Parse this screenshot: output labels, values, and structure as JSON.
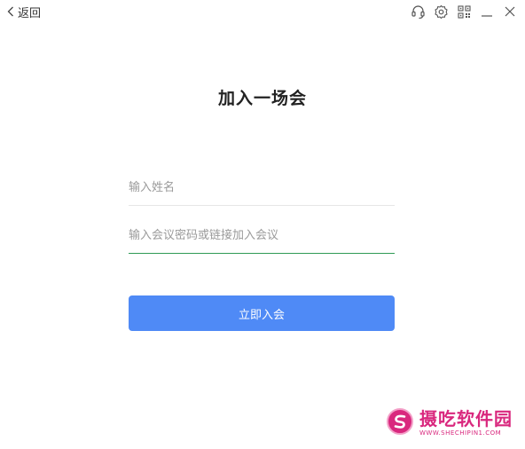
{
  "topbar": {
    "back_label": "返回",
    "icons": [
      "headset-icon",
      "gear-icon",
      "qr-code-icon",
      "minimize-icon",
      "close-icon"
    ]
  },
  "main": {
    "title": "加入一场会",
    "name_placeholder": "输入姓名",
    "name_value": "",
    "meeting_placeholder": "输入会议密码或链接加入会议",
    "meeting_value": "",
    "join_label": "立即入会"
  },
  "watermark": {
    "name": "摄吃软件园",
    "url": "WWW.SHECHIPIN1.COM"
  },
  "colors": {
    "primary": "#4f8af6",
    "active_underline": "#2f9a55",
    "watermark": "#d9287e"
  }
}
